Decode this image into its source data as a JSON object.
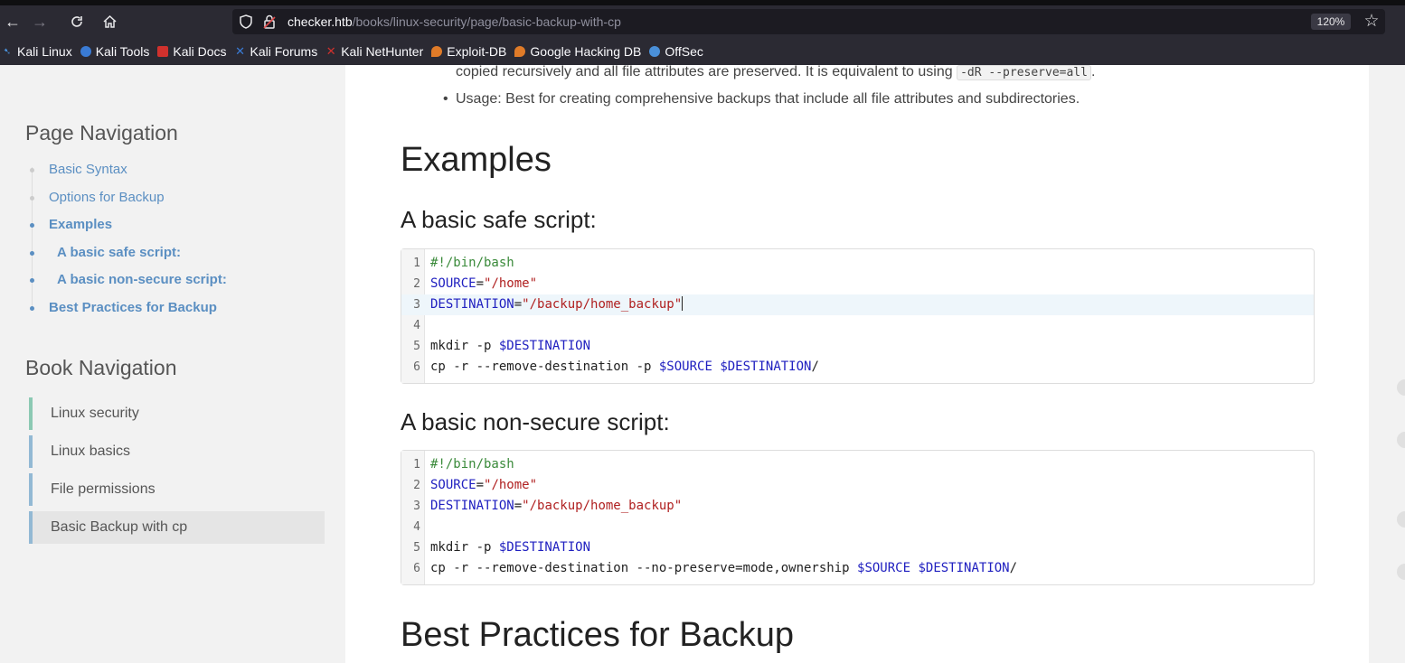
{
  "browser": {
    "url_host": "checker.htb",
    "url_path": "/books/linux-security/page/basic-backup-with-cp",
    "zoom": "120%",
    "icons": {
      "back": "arrow-left-icon",
      "forward": "arrow-right-icon",
      "reload": "reload-icon",
      "home": "home-icon",
      "shield": "shield-icon",
      "lock": "lock-icon",
      "star": "star-icon"
    },
    "bookmarks": [
      {
        "label": "Kali Linux",
        "icon": "kali-dragon-icon",
        "color": "#4a90d9"
      },
      {
        "label": "Kali Tools",
        "icon": "kali-tools-icon",
        "color": "#3a7bd5"
      },
      {
        "label": "Kali Docs",
        "icon": "kali-docs-icon",
        "color": "#d0312d"
      },
      {
        "label": "Kali Forums",
        "icon": "kali-forums-icon",
        "color": "#3a7bd5"
      },
      {
        "label": "Kali NetHunter",
        "icon": "nethunter-icon",
        "color": "#d0312d"
      },
      {
        "label": "Exploit-DB",
        "icon": "exploit-db-icon",
        "color": "#e07b28"
      },
      {
        "label": "Google Hacking DB",
        "icon": "ghdb-icon",
        "color": "#e07b28"
      },
      {
        "label": "OffSec",
        "icon": "offsec-icon",
        "color": "#4a90d9"
      }
    ]
  },
  "sidebar": {
    "page_nav_title": "Page Navigation",
    "page_nav": [
      {
        "label": "Basic Syntax"
      },
      {
        "label": "Options for Backup"
      },
      {
        "label": "Examples"
      },
      {
        "label": "A basic safe script:"
      },
      {
        "label": "A basic non-secure script:"
      },
      {
        "label": "Best Practices for Backup"
      }
    ],
    "book_nav_title": "Book Navigation",
    "book_nav": [
      {
        "label": "Linux security"
      },
      {
        "label": "Linux basics"
      },
      {
        "label": "File permissions"
      },
      {
        "label": "Basic Backup with cp"
      }
    ]
  },
  "content": {
    "intro_text": "copied recursively and all file attributes are preserved. It is equivalent to using ",
    "intro_code": "-dR --preserve=all",
    "intro_end": ".",
    "usage_bullet": "Usage: Best for creating comprehensive backups that include all file attributes and subdirectories.",
    "examples_heading": "Examples",
    "safe_heading": "A basic safe script:",
    "nonsecure_heading": "A basic non-secure script:",
    "best_heading": "Best Practices for Backup",
    "safe_code": {
      "l1": "#!/bin/bash",
      "l2_var": "SOURCE",
      "l2_str": "\"/home\"",
      "l3_var": "DESTINATION",
      "l3_str": "\"/backup/home_backup\"",
      "l5_cmd": "mkdir -p ",
      "l5_var": "$DESTINATION",
      "l6_cmd": "cp -r --remove-destination -p ",
      "l6_var1": "$SOURCE",
      "l6_var2": "$DESTINATION",
      "l6_end": "/"
    },
    "nonsecure_code": {
      "l1": "#!/bin/bash",
      "l2_var": "SOURCE",
      "l2_str": "\"/home\"",
      "l3_var": "DESTINATION",
      "l3_str": "\"/backup/home_backup\"",
      "l5_cmd": "mkdir -p ",
      "l5_var": "$DESTINATION",
      "l6_cmd": "cp -r --remove-destination --no-preserve=mode,ownership ",
      "l6_var1": "$SOURCE",
      "l6_var2": "$DESTINATION",
      "l6_end": "/"
    },
    "line_numbers": [
      "1",
      "2",
      "3",
      "4",
      "5",
      "6"
    ],
    "equals": "="
  }
}
